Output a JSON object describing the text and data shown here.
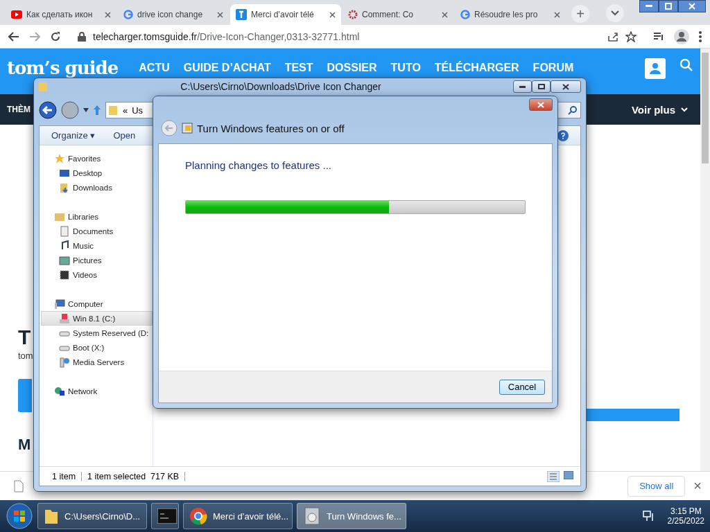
{
  "browser": {
    "tabs": [
      {
        "title": "Как сделать икон",
        "kind": "youtube",
        "selected": false
      },
      {
        "title": "drive icon change",
        "kind": "google",
        "selected": false
      },
      {
        "title": "Merci d’avoir télé",
        "kind": "toms",
        "selected": true
      },
      {
        "title": "Comment: Co",
        "kind": "gear",
        "selected": false
      },
      {
        "title": "Résoudre les pro",
        "kind": "google",
        "selected": false
      }
    ],
    "new_tab": "+",
    "url": {
      "host": "telecharger.tomsguide.fr",
      "path": "/Drive-Icon-Changer,0313-32771.html"
    }
  },
  "website": {
    "logo": "tom’s guide",
    "nav": [
      "ACTU",
      "GUIDE D’ACHAT",
      "TEST",
      "DOSSIER",
      "TUTO",
      "TÉLÉCHARGER",
      "FORUM"
    ],
    "subnav_left": "THÈM",
    "subnav_right": "Voir plus",
    "fragments": {
      "heading": "T",
      "byline": "tom",
      "section": "M"
    }
  },
  "downloads": {
    "show_all": "Show all",
    "close": "×"
  },
  "explorer": {
    "title": "C:\\Users\\Cirno\\Downloads\\Drive Icon Changer",
    "address": "Us",
    "address_prefix": "«",
    "toolbar": [
      "Organize ▾",
      "Open"
    ],
    "sidebar": [
      {
        "label": "Favorites",
        "kind": "star",
        "children": [
          {
            "label": "Desktop",
            "kind": "desktop",
            "selected": false
          },
          {
            "label": "Downloads",
            "kind": "downloads",
            "selected": false
          }
        ]
      },
      {
        "label": "Libraries",
        "kind": "library",
        "children": [
          {
            "label": "Documents",
            "kind": "document",
            "selected": false
          },
          {
            "label": "Music",
            "kind": "music",
            "selected": false
          },
          {
            "label": "Pictures",
            "kind": "pictures",
            "selected": false
          },
          {
            "label": "Videos",
            "kind": "video",
            "selected": false
          }
        ]
      },
      {
        "label": "Computer",
        "kind": "computer",
        "children": [
          {
            "label": "Win 8.1 (C:)",
            "kind": "windrive",
            "selected": true
          },
          {
            "label": "System Reserved (D:",
            "kind": "drive",
            "selected": false
          },
          {
            "label": "Boot (X:)",
            "kind": "drive",
            "selected": false
          },
          {
            "label": "Media Servers",
            "kind": "media",
            "selected": false
          }
        ]
      },
      {
        "label": "Network",
        "kind": "network"
      }
    ],
    "status": [
      "1 item",
      "1 item selected  717 KB"
    ]
  },
  "dialog": {
    "title": "Turn Windows features on or off",
    "message": "Planning changes to features ...",
    "progress": {
      "level": 0.6
    },
    "cancel": "Cancel"
  },
  "taskbar": {
    "items": [
      {
        "label": "C:\\Users\\Cirno\\D...",
        "kind": "folder",
        "selected": false
      },
      {
        "kind": "cmd",
        "selected": false
      },
      {
        "label": "Merci d’avoir télé...",
        "kind": "chrome",
        "selected": false
      },
      {
        "label": "Turn Windows fe...",
        "kind": "features",
        "selected": true
      }
    ],
    "time": "3:15 PM",
    "date": "2/25/2022"
  }
}
